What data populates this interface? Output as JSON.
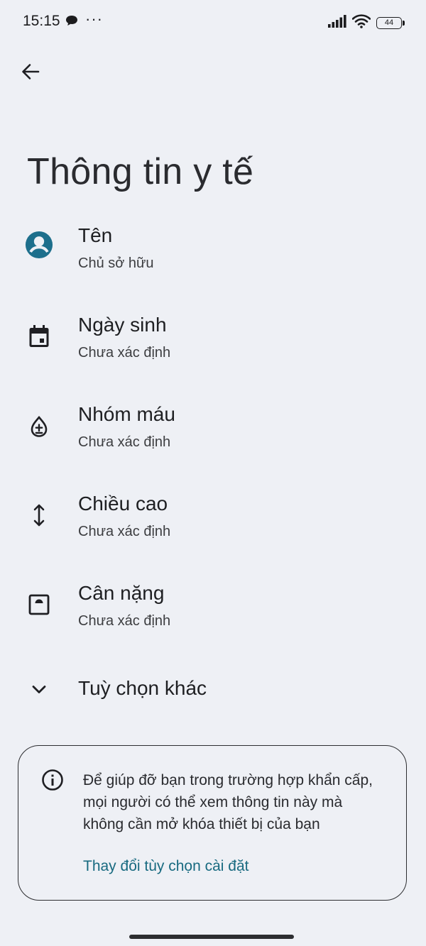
{
  "status_bar": {
    "time": "15:15",
    "dots": "···",
    "battery": "44"
  },
  "page": {
    "title": "Thông tin y tế"
  },
  "items": [
    {
      "title": "Tên",
      "subtitle": "Chủ sở hữu"
    },
    {
      "title": "Ngày sinh",
      "subtitle": "Chưa xác định"
    },
    {
      "title": "Nhóm máu",
      "subtitle": "Chưa xác định"
    },
    {
      "title": "Chiều cao",
      "subtitle": "Chưa xác định"
    },
    {
      "title": "Cân nặng",
      "subtitle": "Chưa xác định"
    }
  ],
  "more_options": {
    "label": "Tuỳ chọn khác"
  },
  "info_card": {
    "text": "Để giúp đỡ bạn trong trường hợp khẩn cấp, mọi người có thể xem thông tin này mà không cần mở khóa thiết bị của bạn",
    "link": "Thay đổi tùy chọn cài đặt"
  },
  "colors": {
    "background": "#eef0f5",
    "accent": "#186a80",
    "avatar": "#1d6f8c"
  },
  "icons": {
    "back": "arrow-back-icon",
    "name": "account-circle-icon",
    "birthday": "calendar-icon",
    "blood": "blood-drop-icon",
    "height": "vertical-arrows-icon",
    "weight": "scale-icon",
    "more": "chevron-down-icon",
    "info": "info-icon"
  }
}
